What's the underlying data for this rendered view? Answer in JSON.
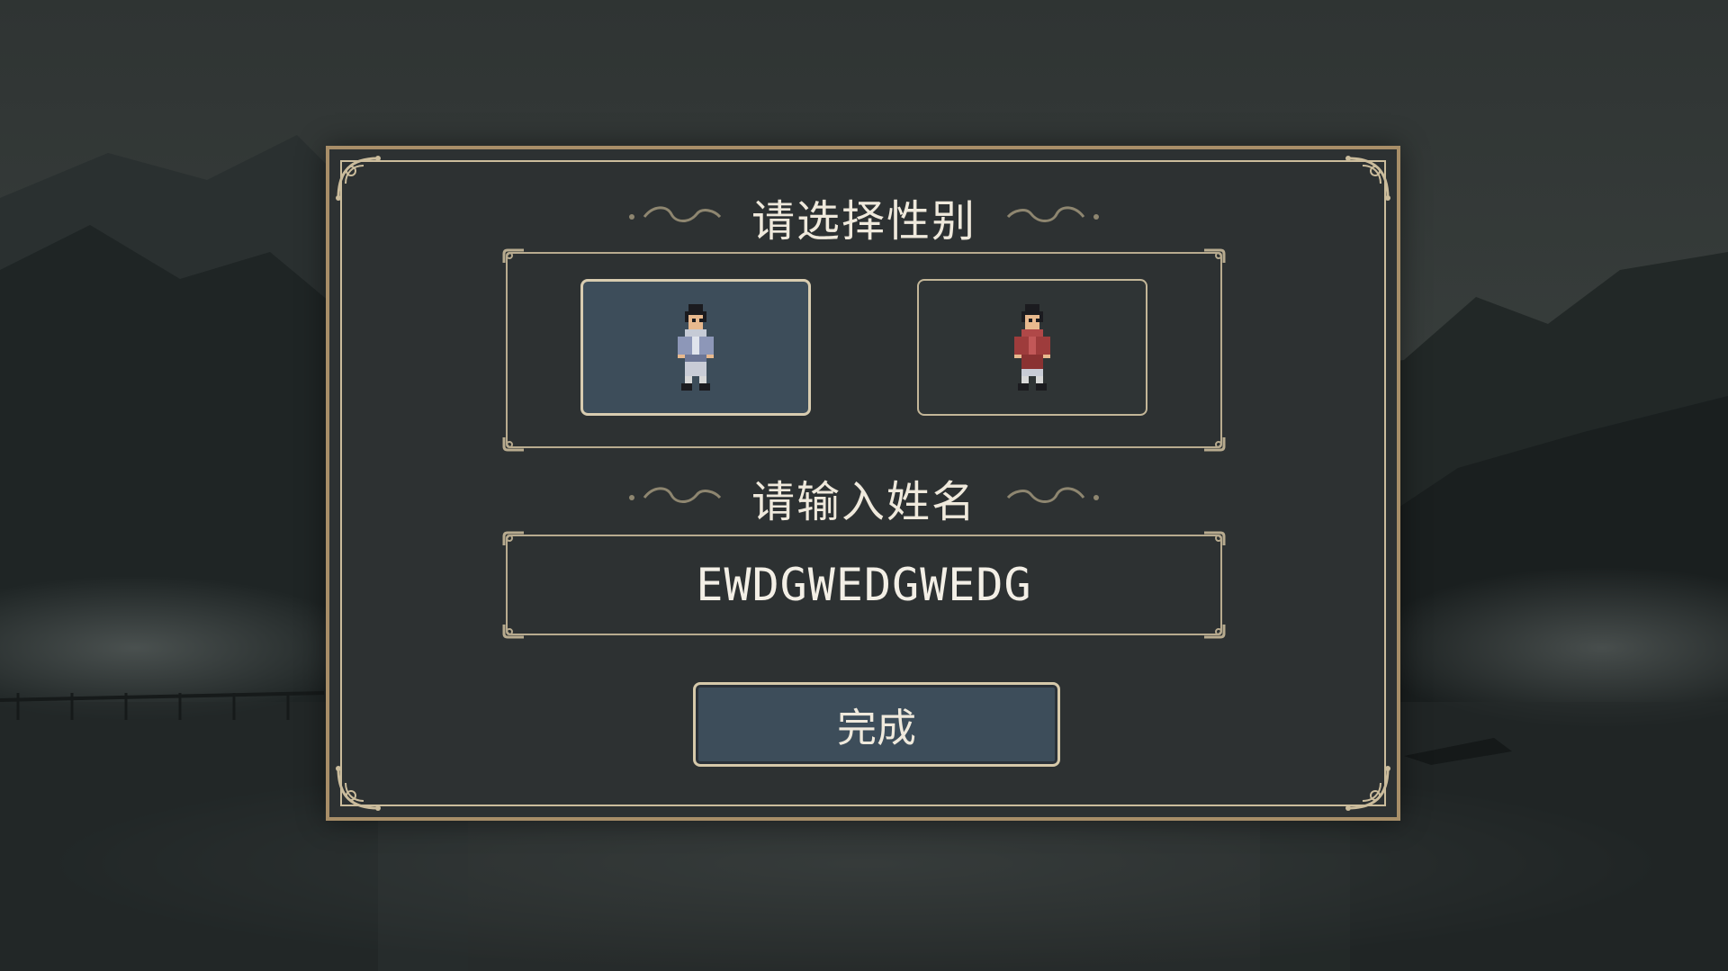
{
  "gender_section": {
    "title": "请选择性别",
    "options": [
      {
        "icon": "male-character-icon",
        "selected": true
      },
      {
        "icon": "female-character-icon",
        "selected": false
      }
    ]
  },
  "name_section": {
    "title": "请输入姓名",
    "value": "EWDGWEDGWEDG"
  },
  "done_button": {
    "label": "完成"
  },
  "colors": {
    "panel": "#2d3132",
    "border_gold": "#a88e68",
    "selected_fill": "#3d4d5a",
    "text": "#efe9dc"
  }
}
